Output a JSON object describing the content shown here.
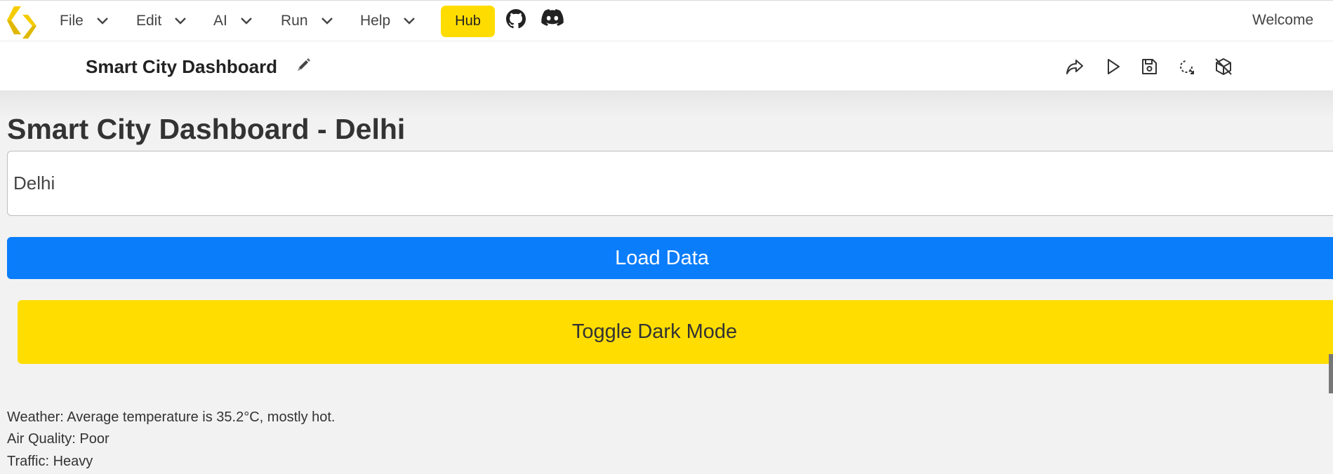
{
  "menubar": {
    "items": [
      {
        "label": "File"
      },
      {
        "label": "Edit"
      },
      {
        "label": "AI"
      },
      {
        "label": "Run"
      },
      {
        "label": "Help"
      }
    ],
    "hub_label": "Hub",
    "welcome": "Welcome",
    "icons": [
      "logo-icon",
      "github-icon",
      "discord-icon"
    ]
  },
  "titlebar": {
    "title": "Smart City Dashboard",
    "icons": [
      "pencil-icon",
      "share-icon",
      "play-icon",
      "save-icon",
      "refresh-icon",
      "box-off-icon"
    ]
  },
  "main": {
    "heading": "Smart City Dashboard - Delhi",
    "city_input_value": "Delhi",
    "load_label": "Load Data",
    "dark_mode_label": "Toggle Dark Mode",
    "weather": "Weather: Average temperature is 35.2°C, mostly hot.",
    "air_quality": "Air Quality: Poor",
    "traffic": "Traffic: Heavy"
  },
  "colors": {
    "accent_yellow": "#ffdc00",
    "primary_blue": "#0a7dfb",
    "background": "#f2f2f2"
  }
}
